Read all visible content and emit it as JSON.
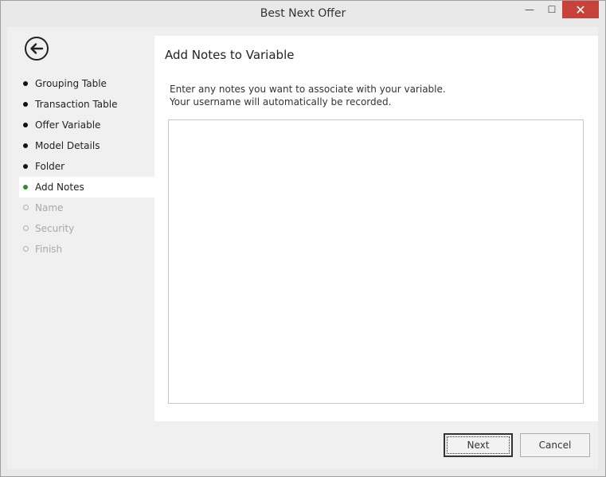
{
  "window": {
    "title": "Best Next Offer",
    "minimize_glyph": "—",
    "maximize_glyph": "☐",
    "close_glyph": "✕"
  },
  "sidebar": {
    "back_icon": "arrow-left-circle-icon",
    "steps": [
      {
        "label": "Grouping Table",
        "state": "done"
      },
      {
        "label": "Transaction Table",
        "state": "done"
      },
      {
        "label": "Offer Variable",
        "state": "done"
      },
      {
        "label": "Model Details",
        "state": "done"
      },
      {
        "label": "Folder",
        "state": "done"
      },
      {
        "label": "Add Notes",
        "state": "current"
      },
      {
        "label": "Name",
        "state": "pending"
      },
      {
        "label": "Security",
        "state": "pending"
      },
      {
        "label": "Finish",
        "state": "pending"
      }
    ]
  },
  "main": {
    "title": "Add Notes to Variable",
    "instruction_line1": "Enter any notes you want to associate with your variable.",
    "instruction_line2": "Your username will automatically be recorded.",
    "notes_value": ""
  },
  "footer": {
    "next_label": "Next",
    "cancel_label": "Cancel"
  },
  "colors": {
    "active_bullet": "#2e8b2e",
    "close_button": "#c7423a"
  }
}
